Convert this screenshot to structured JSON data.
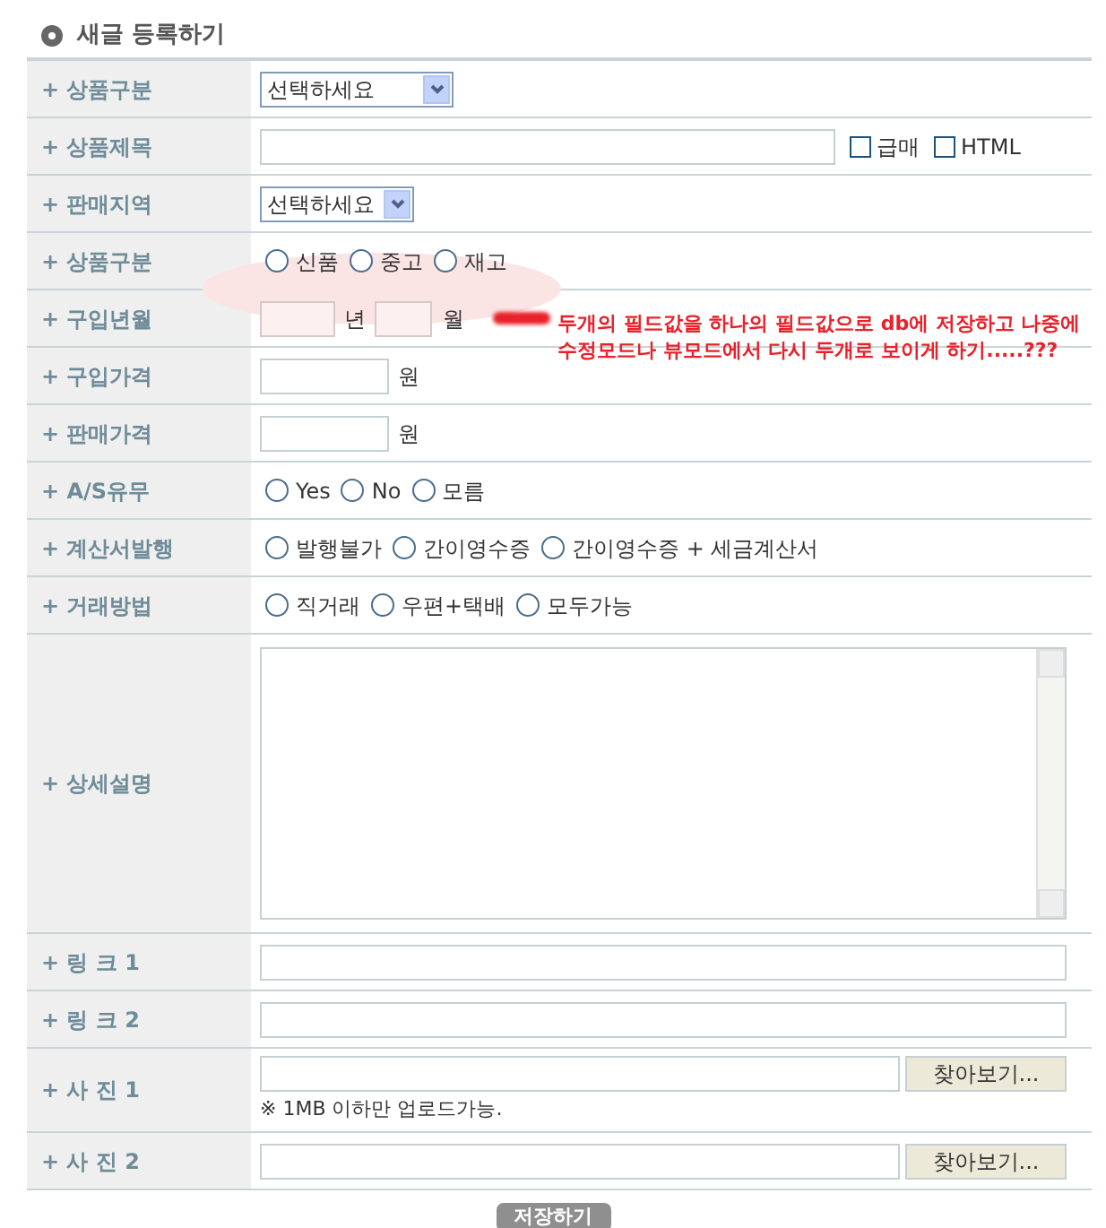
{
  "title": "새글 등록하기",
  "rows": [
    {
      "label": "+ 상품구분",
      "kind": "select",
      "value": "선택하세요",
      "wide": true
    },
    {
      "label": "+ 상품제목",
      "kind": "title",
      "checks": [
        {
          "label": "급매",
          "checked": false
        },
        {
          "label": "HTML",
          "checked": false
        }
      ]
    },
    {
      "label": "+ 판매지역",
      "kind": "select",
      "value": "선택하세요",
      "wide": false
    },
    {
      "label": "+ 상품구분",
      "kind": "radio",
      "options": [
        {
          "label": "신품",
          "selected": false
        },
        {
          "label": "중고",
          "selected": false
        },
        {
          "label": "재고",
          "selected": false
        }
      ]
    },
    {
      "label": "+ 구입년월",
      "kind": "yearmonth",
      "year_unit": "년",
      "month_unit": "월",
      "note": "두개의 필드값을 하나의 필드값으로 db에 저장하고 나중에 수정모드나 뷰모드에서 다시 두개로 보이게 하기.....???"
    },
    {
      "label": "+ 구입가격",
      "kind": "price",
      "unit": "원"
    },
    {
      "label": "+ 판매가격",
      "kind": "price",
      "unit": "원"
    },
    {
      "label": "+ A/S유무",
      "kind": "radio",
      "options": [
        {
          "label": "Yes",
          "selected": false
        },
        {
          "label": "No",
          "selected": false
        },
        {
          "label": "모름",
          "selected": false
        }
      ]
    },
    {
      "label": "+ 계산서발행",
      "kind": "radio",
      "options": [
        {
          "label": "발행불가",
          "selected": false
        },
        {
          "label": "간이영수증",
          "selected": false
        },
        {
          "label": "간이영수증 + 세금계산서",
          "selected": false
        }
      ]
    },
    {
      "label": "+ 거래방법",
      "kind": "radio",
      "options": [
        {
          "label": "직거래",
          "selected": false
        },
        {
          "label": "우편+택배",
          "selected": false
        },
        {
          "label": "모두가능",
          "selected": false
        }
      ]
    },
    {
      "label": "+ 상세설명",
      "kind": "textarea"
    },
    {
      "label": "+ 링 크 1",
      "kind": "text"
    },
    {
      "label": "+ 링 크 2",
      "kind": "text"
    },
    {
      "label": "+ 사 진 1",
      "kind": "file",
      "button": "찾아보기...",
      "hint": "※ 1MB 이하만 업로드가능."
    },
    {
      "label": "+ 사 진 2",
      "kind": "file",
      "button": "찾아보기..."
    }
  ],
  "save_button": "저장하기"
}
